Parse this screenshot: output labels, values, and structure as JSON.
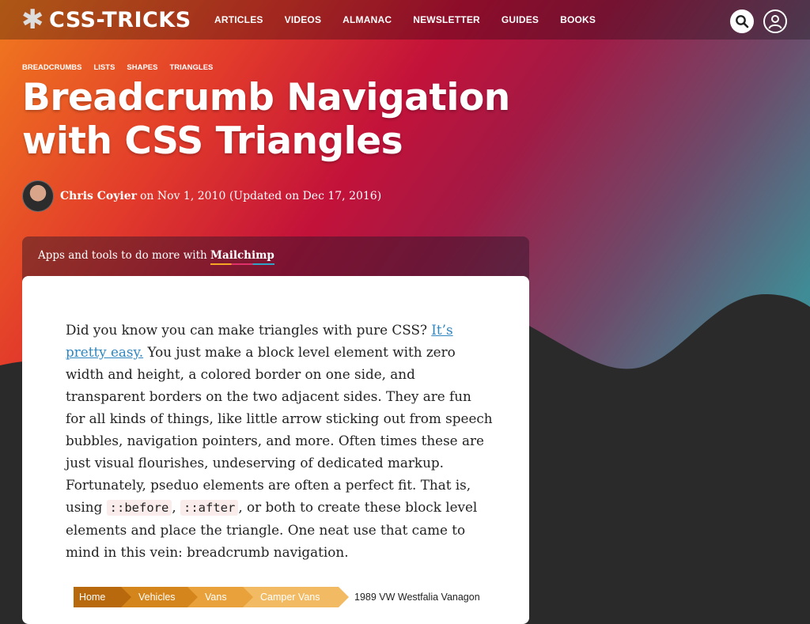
{
  "header": {
    "logo_text": "CSS-TRICKS",
    "logo_icon": "asterisk-icon",
    "nav": [
      "ARTICLES",
      "VIDEOS",
      "ALMANAC",
      "NEWSLETTER",
      "GUIDES",
      "BOOKS"
    ],
    "search_icon": "search-icon",
    "account_icon": "user-icon"
  },
  "article": {
    "tags": [
      "BREADCRUMBS",
      "LISTS",
      "SHAPES",
      "TRIANGLES"
    ],
    "title_line1": "Breadcrumb Navigation",
    "title_line2": "with CSS Triangles",
    "author": "Chris Coyier",
    "date_text": "on Nov 1, 2010 (Updated on Dec 17, 2016)"
  },
  "promo": {
    "text": "Apps and tools to do more with ",
    "link": "Mailchimp"
  },
  "body": {
    "p1": "Did you know you can make triangles with pure CSS? ",
    "p1_link": "It’s pretty easy.",
    "p2": " You just make a block level element with zero width and height, a colored border on one side, and transparent borders on the two adjacent sides. They are fun for all kinds of things, like little arrow sticking out from speech bubbles, navigation pointers, and more. Often times these are just visual flourishes, undeserving of dedicated markup. Fortunately, pseduo elements are often a perfect fit. That is, using ",
    "code1": "::before",
    "sep": ", ",
    "code2": "::after",
    "p3": ", or both to create these block level elements and place the triangle. One neat use that came to mind in this vein: breadcrumb navigation."
  },
  "demo_breadcrumb": {
    "items": [
      "Home",
      "Vehicles",
      "Vans",
      "Camper Vans",
      "1989 VW Westfalia Vanagon"
    ],
    "colors": [
      "#b8690e",
      "#d4861c",
      "#e9a23b",
      "#f2bb63"
    ]
  },
  "colors": {
    "background_dark": "#2a2a2a",
    "link": "#2f86c1",
    "gradient_start": "#f07a1e",
    "gradient_mid": "#c3123a",
    "gradient_end": "#2e9aa2"
  }
}
